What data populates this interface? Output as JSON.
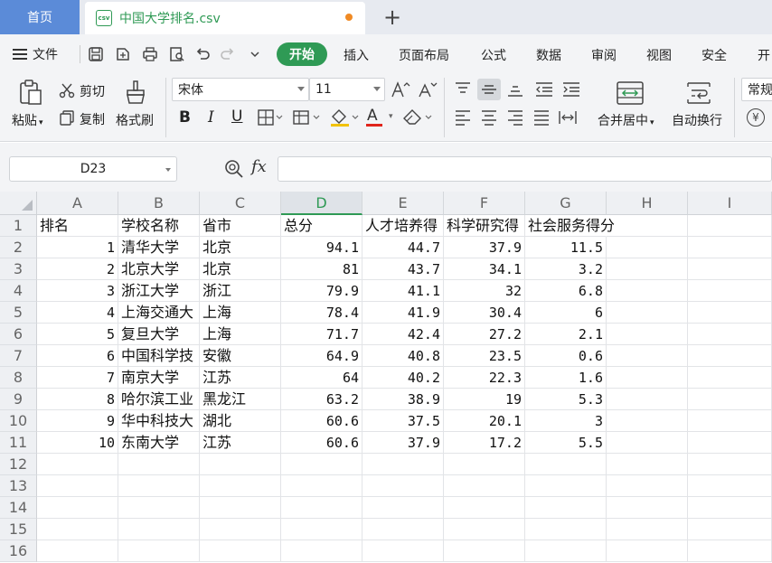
{
  "tabs": {
    "home": "首页",
    "file_icon": "csv",
    "file_title": "中国大学排名.csv",
    "add": "+"
  },
  "menu": {
    "file": "文件",
    "items": [
      "开始",
      "插入",
      "页面布局",
      "公式",
      "数据",
      "审阅",
      "视图",
      "安全",
      "开"
    ]
  },
  "ribbon": {
    "paste": "粘贴",
    "cut": "剪切",
    "copy": "复制",
    "format_painter": "格式刷",
    "font_name": "宋体",
    "font_size": "11",
    "bold": "B",
    "italic": "I",
    "underline": "U",
    "font_color_letter": "A",
    "merge_center": "合并居中",
    "wrap_text": "自动换行",
    "number_format": "常规",
    "currency": "¥"
  },
  "formula_bar": {
    "cell_ref": "D23",
    "fx": "fx",
    "value": ""
  },
  "colors": {
    "accent": "#2f9a55",
    "home_tab": "#5b8bd8",
    "modified_dot": "#f08a24"
  },
  "sheet": {
    "columns": [
      "A",
      "B",
      "C",
      "D",
      "E",
      "F",
      "G",
      "H",
      "I"
    ],
    "selected_column": "D",
    "row_numbers": [
      "1",
      "2",
      "3",
      "4",
      "5",
      "6",
      "7",
      "8",
      "9",
      "10",
      "11",
      "12",
      "13",
      "14",
      "15",
      "16"
    ],
    "header_row": [
      "排名",
      "学校名称",
      "省市",
      "总分",
      "人才培养得",
      "科学研究得",
      "社会服务得分"
    ],
    "rows": [
      [
        "1",
        "清华大学",
        "北京",
        "94.1",
        "44.7",
        "37.9",
        "11.5"
      ],
      [
        "2",
        "北京大学",
        "北京",
        "81",
        "43.7",
        "34.1",
        "3.2"
      ],
      [
        "3",
        "浙江大学",
        "浙江",
        "79.9",
        "41.1",
        "32",
        "6.8"
      ],
      [
        "4",
        "上海交通大",
        "上海",
        "78.4",
        "41.9",
        "30.4",
        "6"
      ],
      [
        "5",
        "复旦大学",
        "上海",
        "71.7",
        "42.4",
        "27.2",
        "2.1"
      ],
      [
        "6",
        "中国科学技",
        "安徽",
        "64.9",
        "40.8",
        "23.5",
        "0.6"
      ],
      [
        "7",
        "南京大学",
        "江苏",
        "64",
        "40.2",
        "22.3",
        "1.6"
      ],
      [
        "8",
        "哈尔滨工业",
        "黑龙江",
        "63.2",
        "38.9",
        "19",
        "5.3"
      ],
      [
        "9",
        "华中科技大",
        "湖北",
        "60.6",
        "37.5",
        "20.1",
        "3"
      ],
      [
        "10",
        "东南大学",
        "江苏",
        "60.6",
        "37.9",
        "17.2",
        "5.5"
      ]
    ]
  }
}
